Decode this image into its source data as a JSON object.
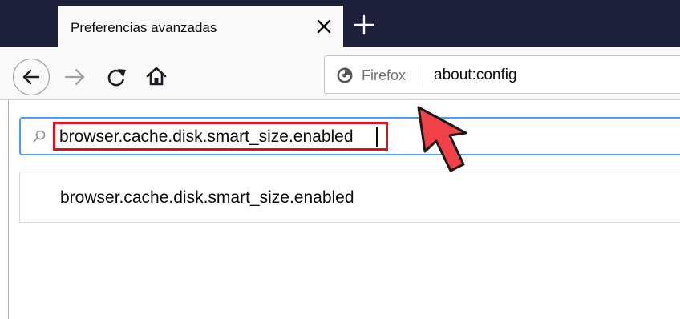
{
  "tab": {
    "title": "Preferencias avanzadas",
    "close_icon": "close-icon",
    "new_tab_icon": "plus-icon"
  },
  "navbar": {
    "back_icon": "arrow-left-icon",
    "forward_icon": "arrow-right-icon",
    "reload_icon": "reload-icon",
    "home_icon": "home-icon",
    "identity_label": "Firefox",
    "url": "about:config"
  },
  "config": {
    "search_value": "browser.cache.disk.smart_size.enabled",
    "result_name": "browser.cache.disk.smart_size.enabled"
  },
  "colors": {
    "tabstrip": "#1d1f3b",
    "focus_ring": "#45a1ff",
    "highlight": "#e0101a",
    "annotation_arrow": "#f04048"
  }
}
